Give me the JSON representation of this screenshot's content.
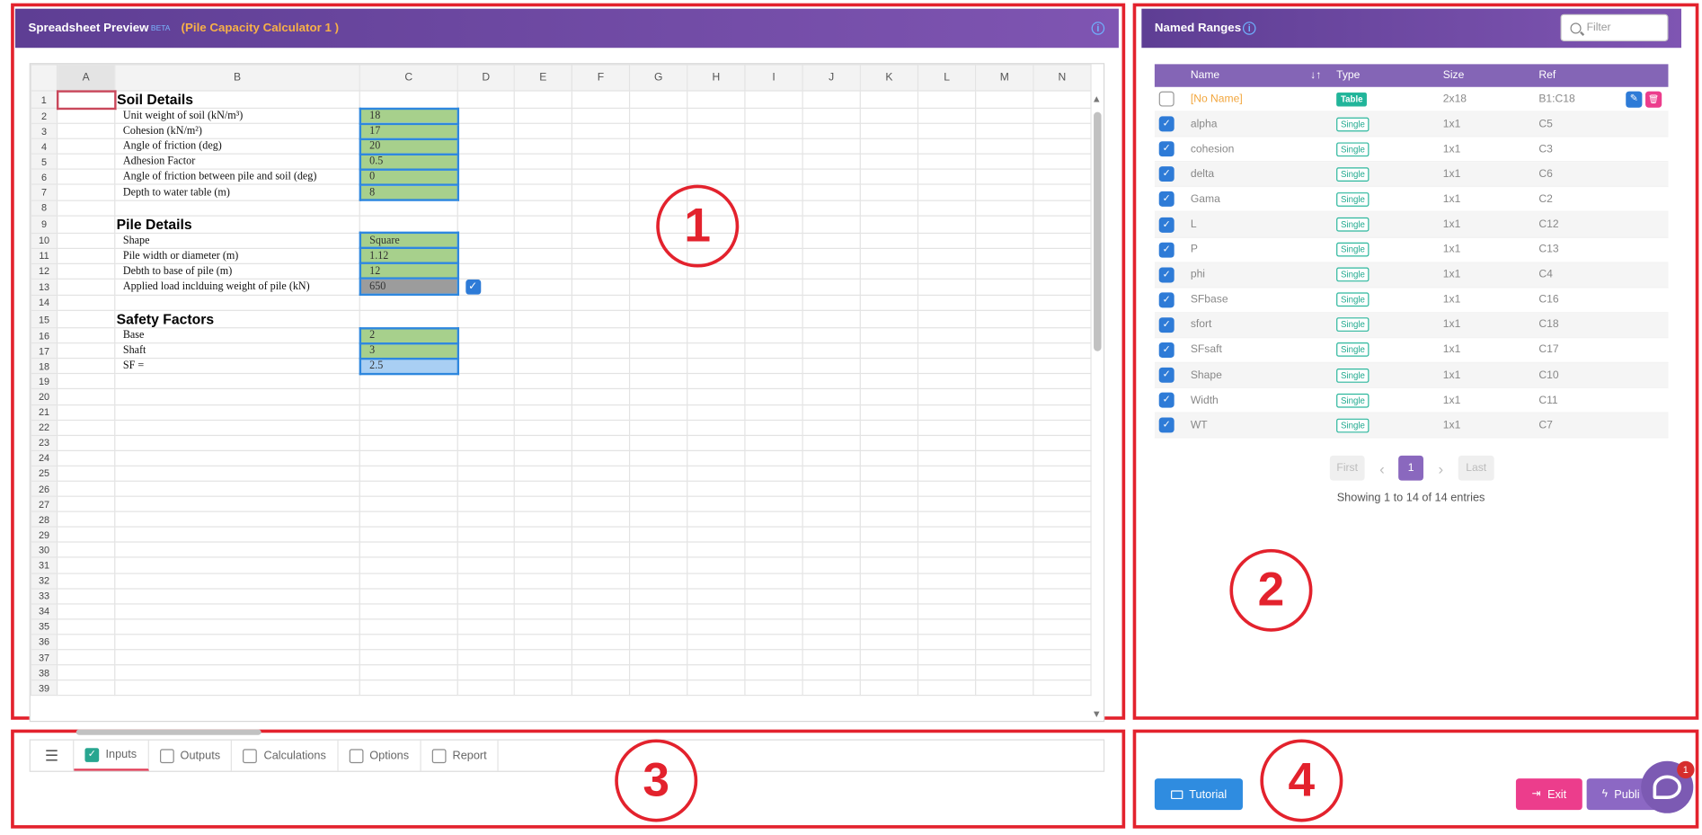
{
  "annotations": [
    "1",
    "2",
    "3",
    "4"
  ],
  "sheet_panel": {
    "title": "Spreadsheet Preview",
    "beta": "BETA",
    "file_name": "(Pile Capacity Calculator 1 )",
    "info_icon": "info-icon"
  },
  "spreadsheet": {
    "columns": [
      "A",
      "B",
      "C",
      "D",
      "E",
      "F",
      "G",
      "H",
      "I",
      "J",
      "K",
      "L",
      "M",
      "N"
    ],
    "rows": [
      {
        "n": "1",
        "b": "Soil Details",
        "c": "",
        "type": "section"
      },
      {
        "n": "2",
        "b": "Unit weight of soil (kN/m³)",
        "c": "18",
        "type": "input"
      },
      {
        "n": "3",
        "b": "Cohesion (kN/m²)",
        "c": "17",
        "type": "input"
      },
      {
        "n": "4",
        "b": "Angle of friction (deg)",
        "c": "20",
        "type": "input"
      },
      {
        "n": "5",
        "b": "Adhesion Factor",
        "c": "0.5",
        "type": "input"
      },
      {
        "n": "6",
        "b": "Angle of friction between pile and soil (deg)",
        "c": "0",
        "type": "input"
      },
      {
        "n": "7",
        "b": "Depth to  water table (m)",
        "c": "8",
        "type": "input"
      },
      {
        "n": "8",
        "b": "",
        "c": "",
        "type": "empty"
      },
      {
        "n": "9",
        "b": "Pile Details",
        "c": "",
        "type": "section"
      },
      {
        "n": "10",
        "b": "Shape",
        "c": "Square",
        "type": "input"
      },
      {
        "n": "11",
        "b": "Pile width or diameter (m)",
        "c": "1.12",
        "type": "input"
      },
      {
        "n": "12",
        "b": "Debth to base of pile (m)",
        "c": "12",
        "type": "input"
      },
      {
        "n": "13",
        "b": "Applied load inclduing weight of pile (kN)",
        "c": "650",
        "type": "input-gray"
      },
      {
        "n": "14",
        "b": "",
        "c": "",
        "type": "empty"
      },
      {
        "n": "15",
        "b": "Safety Factors",
        "c": "",
        "type": "section"
      },
      {
        "n": "16",
        "b": "Base",
        "c": "2",
        "type": "input"
      },
      {
        "n": "17",
        "b": "Shaft",
        "c": "3",
        "type": "input"
      },
      {
        "n": "18",
        "b": "SF =",
        "c": "2.5",
        "type": "input-blue"
      },
      {
        "n": "19"
      },
      {
        "n": "20"
      },
      {
        "n": "21"
      },
      {
        "n": "22"
      },
      {
        "n": "23"
      },
      {
        "n": "24"
      },
      {
        "n": "25"
      },
      {
        "n": "26"
      },
      {
        "n": "27"
      },
      {
        "n": "28"
      },
      {
        "n": "29"
      },
      {
        "n": "30"
      },
      {
        "n": "31"
      },
      {
        "n": "32"
      },
      {
        "n": "33"
      },
      {
        "n": "34"
      },
      {
        "n": "35"
      },
      {
        "n": "36"
      },
      {
        "n": "37"
      },
      {
        "n": "38"
      },
      {
        "n": "39"
      }
    ],
    "checkbox_row": "13"
  },
  "sheet_tabs": [
    {
      "label": "Inputs",
      "active": true
    },
    {
      "label": "Outputs",
      "active": false
    },
    {
      "label": "Calculations",
      "active": false
    },
    {
      "label": "Options",
      "active": false
    },
    {
      "label": "Report",
      "active": false
    }
  ],
  "named_ranges": {
    "title": "Named Ranges",
    "filter_placeholder": "Filter",
    "headers": {
      "name": "Name",
      "type": "Type",
      "size": "Size",
      "ref": "Ref"
    },
    "rows": [
      {
        "name": "[No Name]",
        "type": "Table",
        "size": "2x18",
        "ref": "B1:C18",
        "checked": false
      },
      {
        "name": "alpha",
        "type": "Single",
        "size": "1x1",
        "ref": "C5",
        "checked": true
      },
      {
        "name": "cohesion",
        "type": "Single",
        "size": "1x1",
        "ref": "C3",
        "checked": true
      },
      {
        "name": "delta",
        "type": "Single",
        "size": "1x1",
        "ref": "C6",
        "checked": true
      },
      {
        "name": "Gama",
        "type": "Single",
        "size": "1x1",
        "ref": "C2",
        "checked": true
      },
      {
        "name": "L",
        "type": "Single",
        "size": "1x1",
        "ref": "C12",
        "checked": true
      },
      {
        "name": "P",
        "type": "Single",
        "size": "1x1",
        "ref": "C13",
        "checked": true
      },
      {
        "name": "phi",
        "type": "Single",
        "size": "1x1",
        "ref": "C4",
        "checked": true
      },
      {
        "name": "SFbase",
        "type": "Single",
        "size": "1x1",
        "ref": "C16",
        "checked": true
      },
      {
        "name": "sfort",
        "type": "Single",
        "size": "1x1",
        "ref": "C18",
        "checked": true
      },
      {
        "name": "SFsaft",
        "type": "Single",
        "size": "1x1",
        "ref": "C17",
        "checked": true
      },
      {
        "name": "Shape",
        "type": "Single",
        "size": "1x1",
        "ref": "C10",
        "checked": true
      },
      {
        "name": "Width",
        "type": "Single",
        "size": "1x1",
        "ref": "C11",
        "checked": true
      },
      {
        "name": "WT",
        "type": "Single",
        "size": "1x1",
        "ref": "C7",
        "checked": true
      }
    ],
    "pagination": {
      "first": "First",
      "prev": "‹",
      "page": "1",
      "next": "›",
      "last": "Last"
    },
    "showing": "Showing 1 to 14 of 14 entries"
  },
  "actions": {
    "tutorial": "Tutorial",
    "exit": "Exit",
    "publish": "Publi",
    "chat_badge": "1"
  },
  "colors": {
    "header": "#6b4ba3",
    "accent": "#2e7bd7",
    "exit": "#ec3d8c",
    "publish": "#8c68c4",
    "input": "#a7d08c",
    "zone": "#e3222d"
  }
}
